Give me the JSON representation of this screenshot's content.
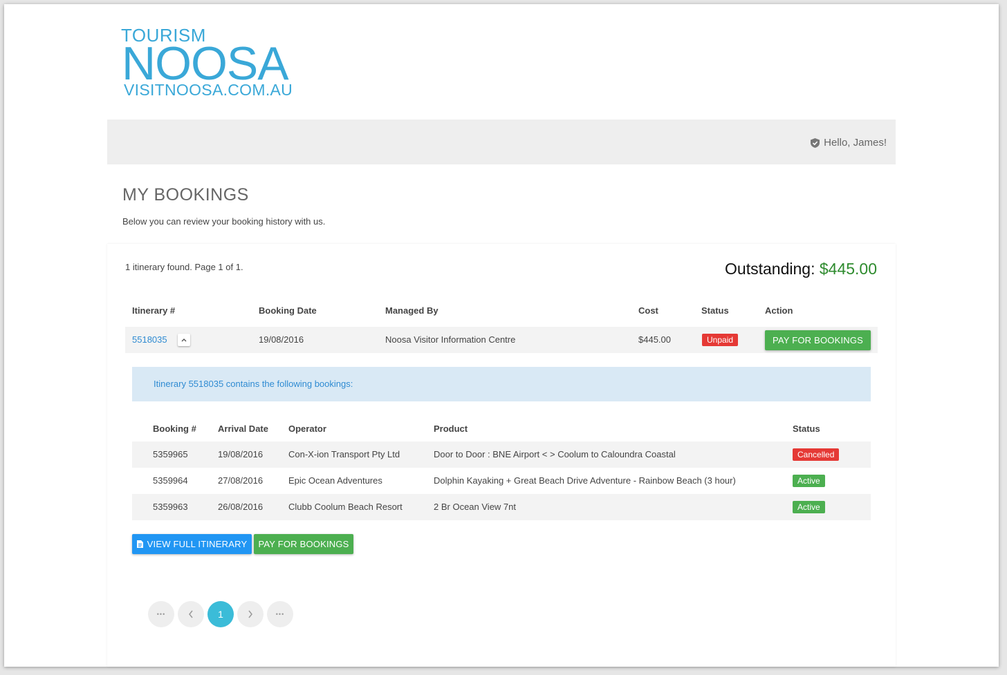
{
  "logo": {
    "line1": "TOURISM",
    "line2": "NOOSA",
    "line3": "VISITNOOSA.COM.AU"
  },
  "header": {
    "greeting": "Hello, James!"
  },
  "page": {
    "title": "MY BOOKINGS",
    "subtitle": "Below you can review your booking history with us."
  },
  "summary": {
    "found_text": "1 itinerary found. Page 1 of 1.",
    "outstanding_label": "Outstanding:",
    "outstanding_amount": "$445.00"
  },
  "itinerary_table": {
    "headers": [
      "Itinerary #",
      "Booking Date",
      "Managed By",
      "Cost",
      "Status",
      "Action"
    ],
    "rows": [
      {
        "itinerary": "5518035",
        "booking_date": "19/08/2016",
        "managed_by": "Noosa Visitor Information Centre",
        "cost": "$445.00",
        "status": "Unpaid",
        "action": "PAY FOR BOOKINGS"
      }
    ]
  },
  "details": {
    "info": "Itinerary 5518035 contains the following bookings:",
    "headers": [
      "Booking #",
      "Arrival Date",
      "Operator",
      "Product",
      "Status"
    ],
    "rows": [
      {
        "booking": "5359965",
        "arrival": "19/08/2016",
        "operator": "Con-X-ion Transport Pty Ltd",
        "product": "Door to Door : BNE Airport < > Coolum to Caloundra Coastal",
        "status": "Cancelled"
      },
      {
        "booking": "5359964",
        "arrival": "27/08/2016",
        "operator": "Epic Ocean Adventures",
        "product": "Dolphin Kayaking + Great Beach Drive Adventure - Rainbow Beach (3 hour)",
        "status": "Active"
      },
      {
        "booking": "5359963",
        "arrival": "26/08/2016",
        "operator": "Clubb Coolum Beach Resort",
        "product": "2 Br Ocean View 7nt",
        "status": "Active"
      }
    ]
  },
  "buttons": {
    "view_itinerary": "VIEW FULL ITINERARY",
    "pay": "PAY FOR BOOKINGS"
  },
  "pagination": {
    "current": "1",
    "ellipsis": "•••"
  },
  "colors": {
    "brand": "#3aa8d8",
    "link": "#2f8bd2",
    "green": "#4caf50",
    "red": "#e53935",
    "blue": "#2196f3",
    "pager_active": "#3bbcd8"
  }
}
